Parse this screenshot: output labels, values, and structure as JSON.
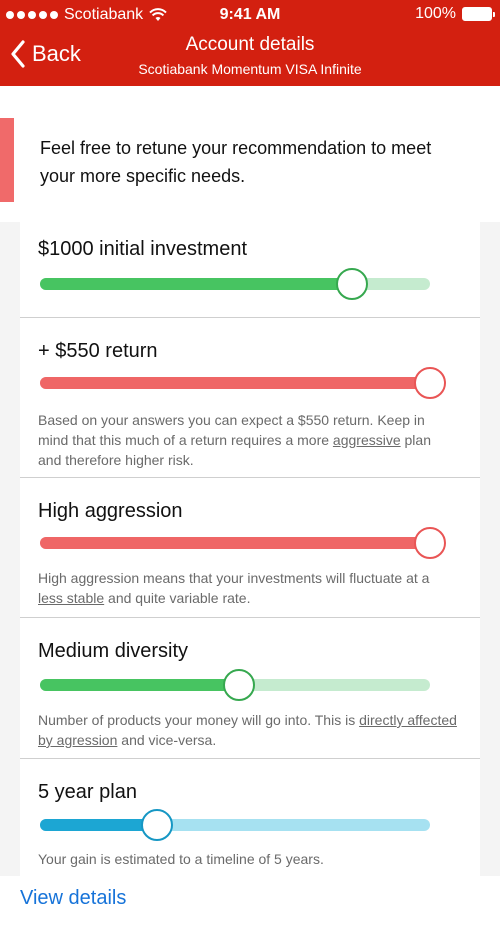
{
  "status_bar": {
    "carrier": "Scotiabank",
    "time": "9:41 AM",
    "battery": "100%"
  },
  "nav": {
    "back_label": "Back",
    "title": "Account details",
    "subtitle": "Scotiabank Momentum VISA Infinite"
  },
  "intro": {
    "text": "Feel free to retune your recommendation to meet your more specific needs."
  },
  "cards": [
    {
      "title": "$1000 initial investment",
      "slider_value": 0.8,
      "color": "#47c461"
    },
    {
      "title": "+ $550 return",
      "slider_value": 1.0,
      "color": "#ef6666",
      "desc_parts": [
        "Based on your answers you can expect a $550 return. Keep in mind that this much of a return requires a more ",
        "aggressive",
        " plan and therefore higher risk."
      ]
    },
    {
      "title": "High aggression",
      "slider_value": 1.0,
      "color": "#ef6666",
      "desc_parts": [
        "High aggression means that your investments will fluctuate at a ",
        "less stable",
        " and quite variable rate."
      ]
    },
    {
      "title": "Medium diversity",
      "slider_value": 0.51,
      "color": "#47c461",
      "desc_parts": [
        "Number of products your money will go into. This is ",
        "directly affected by agression",
        " and vice-versa."
      ]
    },
    {
      "title": "5 year plan",
      "slider_value": 0.3,
      "color": "#1ca6d3",
      "desc_parts": [
        "Your gain is estimated to a timeline of 5 years."
      ]
    }
  ],
  "footer": {
    "link": "View details"
  }
}
